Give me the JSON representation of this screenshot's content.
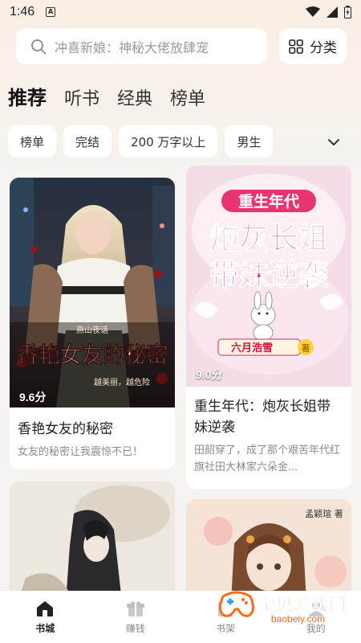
{
  "status": {
    "time": "1:46",
    "app_badge": "A"
  },
  "search": {
    "placeholder": "冲喜新娘：神秘大佬放肆宠"
  },
  "category_button": {
    "label": "分类"
  },
  "tabs": [
    {
      "label": "推荐",
      "active": true
    },
    {
      "label": "听书"
    },
    {
      "label": "经典"
    },
    {
      "label": "榜单"
    }
  ],
  "filters": [
    {
      "label": "榜单"
    },
    {
      "label": "完结"
    },
    {
      "label": "200 万字以上"
    },
    {
      "label": "男生"
    }
  ],
  "books": [
    {
      "cover_title": "香艳女友的秘密",
      "cover_author": "燕山夜话",
      "cover_tagline": "越美丽，越危险",
      "score": "9.6分",
      "title": "香艳女友的秘密",
      "desc": "女友的秘密让我震惊不已！"
    },
    {
      "cover_top": "重生年代",
      "cover_line1": "炮灰长姐",
      "cover_line2": "带妹逆袭",
      "cover_author": "六月浩雪",
      "cover_author_suffix": "著",
      "score": "9.0分",
      "title": "重生年代：炮灰长姐带妹逆袭",
      "desc": "田韶穿了，成了那个艰苦年代红旗社田大林家六朵金..."
    },
    {
      "cover_author": "孟颖瑄 著"
    }
  ],
  "nav": [
    {
      "label": "书城",
      "icon": "home-icon",
      "active": true
    },
    {
      "label": "赚钱",
      "icon": "gift-icon"
    },
    {
      "label": "书架",
      "icon": "bookshelf-icon"
    },
    {
      "label": "我的",
      "icon": "profile-icon"
    }
  ],
  "watermark": {
    "text": "宝贝游戏网",
    "url": "baobeiy.com"
  },
  "colors": {
    "accent": "#ff8a3d",
    "background": "#f6f3f1",
    "card": "#ffffff"
  }
}
